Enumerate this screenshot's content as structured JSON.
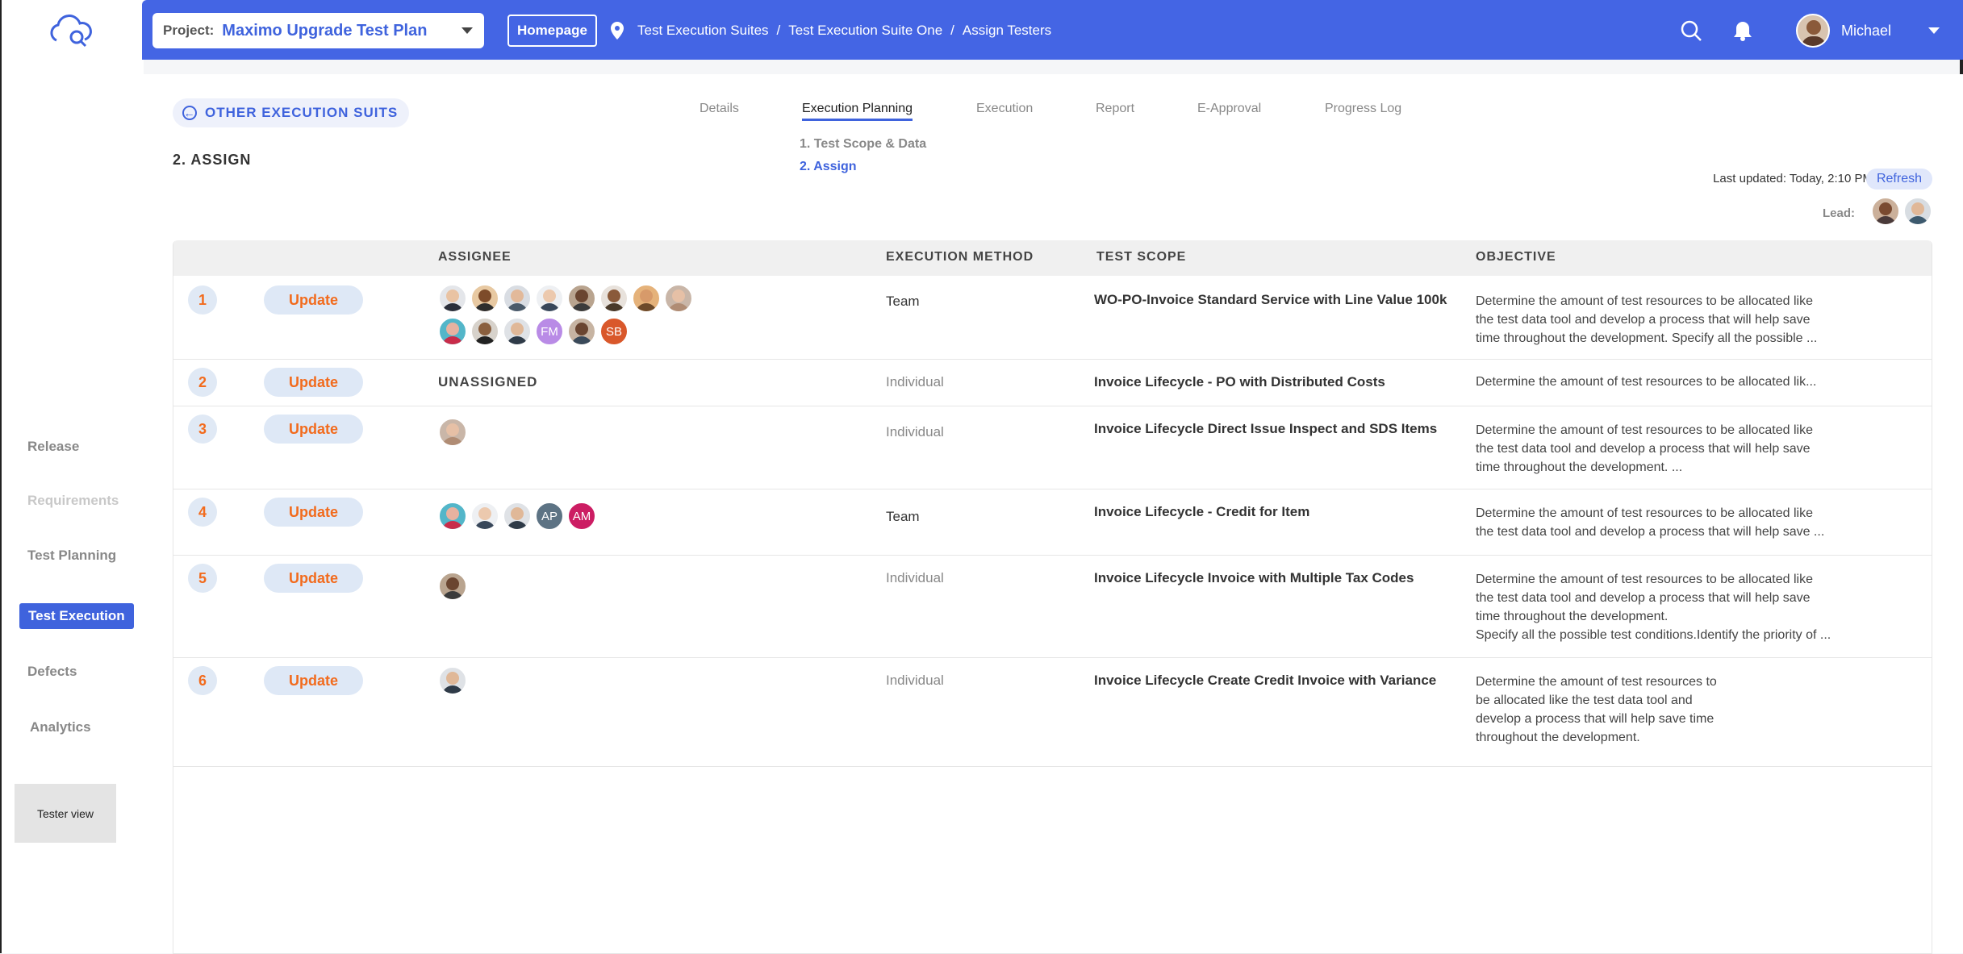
{
  "sidebar": {
    "items": [
      {
        "label": "Release",
        "state": "normal"
      },
      {
        "label": "Requirements",
        "state": "dim"
      },
      {
        "label": "Test Planning",
        "state": "normal"
      },
      {
        "label": "Test Execution",
        "state": "active"
      },
      {
        "label": "Defects",
        "state": "normal"
      },
      {
        "label": "Analytics",
        "state": "normal"
      }
    ],
    "tester_view": "Tester view"
  },
  "header": {
    "project_label": "Project:",
    "project_value": "Maximo Upgrade Test Plan",
    "homepage": "Homepage",
    "breadcrumb": [
      "Test Execution Suites",
      "Test Execution Suite One",
      "Assign Testers"
    ],
    "breadcrumb_sep": "/",
    "user_name": "Michael"
  },
  "main": {
    "back_label": "OTHER EXECUTION SUITS",
    "page_title": "2. ASSIGN",
    "tabs": [
      "Details",
      "Execution Planning",
      "Execution",
      "Report",
      "E-Approval",
      "Progress Log"
    ],
    "active_tab": "Execution Planning",
    "subtabs": [
      "1. Test Scope & Data",
      "2. Assign"
    ],
    "active_subtab": "2. Assign",
    "last_updated": "Last updated: Today, 2:10 PM",
    "refresh": "Refresh",
    "lead_label": "Lead:"
  },
  "table": {
    "headers": {
      "assignee": "ASSIGNEE",
      "method": "EXECUTION METHOD",
      "scope": "TEST SCOPE",
      "objective": "OBJECTIVE"
    },
    "update_label": "Update",
    "unassigned_label": "UNASSIGNED",
    "rows": [
      {
        "num": "1",
        "method": "Team",
        "scope": "WO-PO-Invoice Standard Service with Line Value 100k",
        "objective": "Determine the amount of test resources to be allocated like\nthe test data tool and develop a process that will help save\ntime throughout the development. Specify all the possible ..."
      },
      {
        "num": "2",
        "method": "Individual",
        "scope": "Invoice Lifecycle - PO with Distributed Costs",
        "objective": "Determine the amount of test resources to be allocated lik..."
      },
      {
        "num": "3",
        "method": "Individual",
        "scope": "Invoice Lifecycle Direct Issue Inspect and SDS Items",
        "objective": "Determine the amount of test resources to be allocated like\nthe test data tool and develop a process that will help save\ntime throughout the development. ..."
      },
      {
        "num": "4",
        "method": "Team",
        "scope": "Invoice Lifecycle - Credit for Item",
        "objective": "Determine the amount of test resources to be allocated like\nthe test data tool and develop a process that will help save ..."
      },
      {
        "num": "5",
        "method": "Individual",
        "scope": "Invoice Lifecycle Invoice with Multiple Tax Codes",
        "objective": "Determine the amount of test resources to be allocated like\nthe test data tool and develop a process that will help save\ntime throughout the development.\nSpecify all the possible test conditions.Identify the priority of ..."
      },
      {
        "num": "6",
        "method": "Individual",
        "scope": "Invoice Lifecycle Create Credit Invoice with Variance",
        "objective": "Determine the amount of test resources to\nbe allocated like the test data tool and\ndevelop a process that will help save time\nthroughout the development."
      }
    ],
    "initials": {
      "fm": "FM",
      "sb": "SB",
      "ap": "AP",
      "am": "AM"
    }
  },
  "colors": {
    "accent": "#3f63dd",
    "topbar": "#4465e4",
    "orange": "#f26b1d",
    "fm": "#b98be6",
    "sb": "#d9582b",
    "ap": "#5d7384",
    "am": "#cc1d63"
  }
}
